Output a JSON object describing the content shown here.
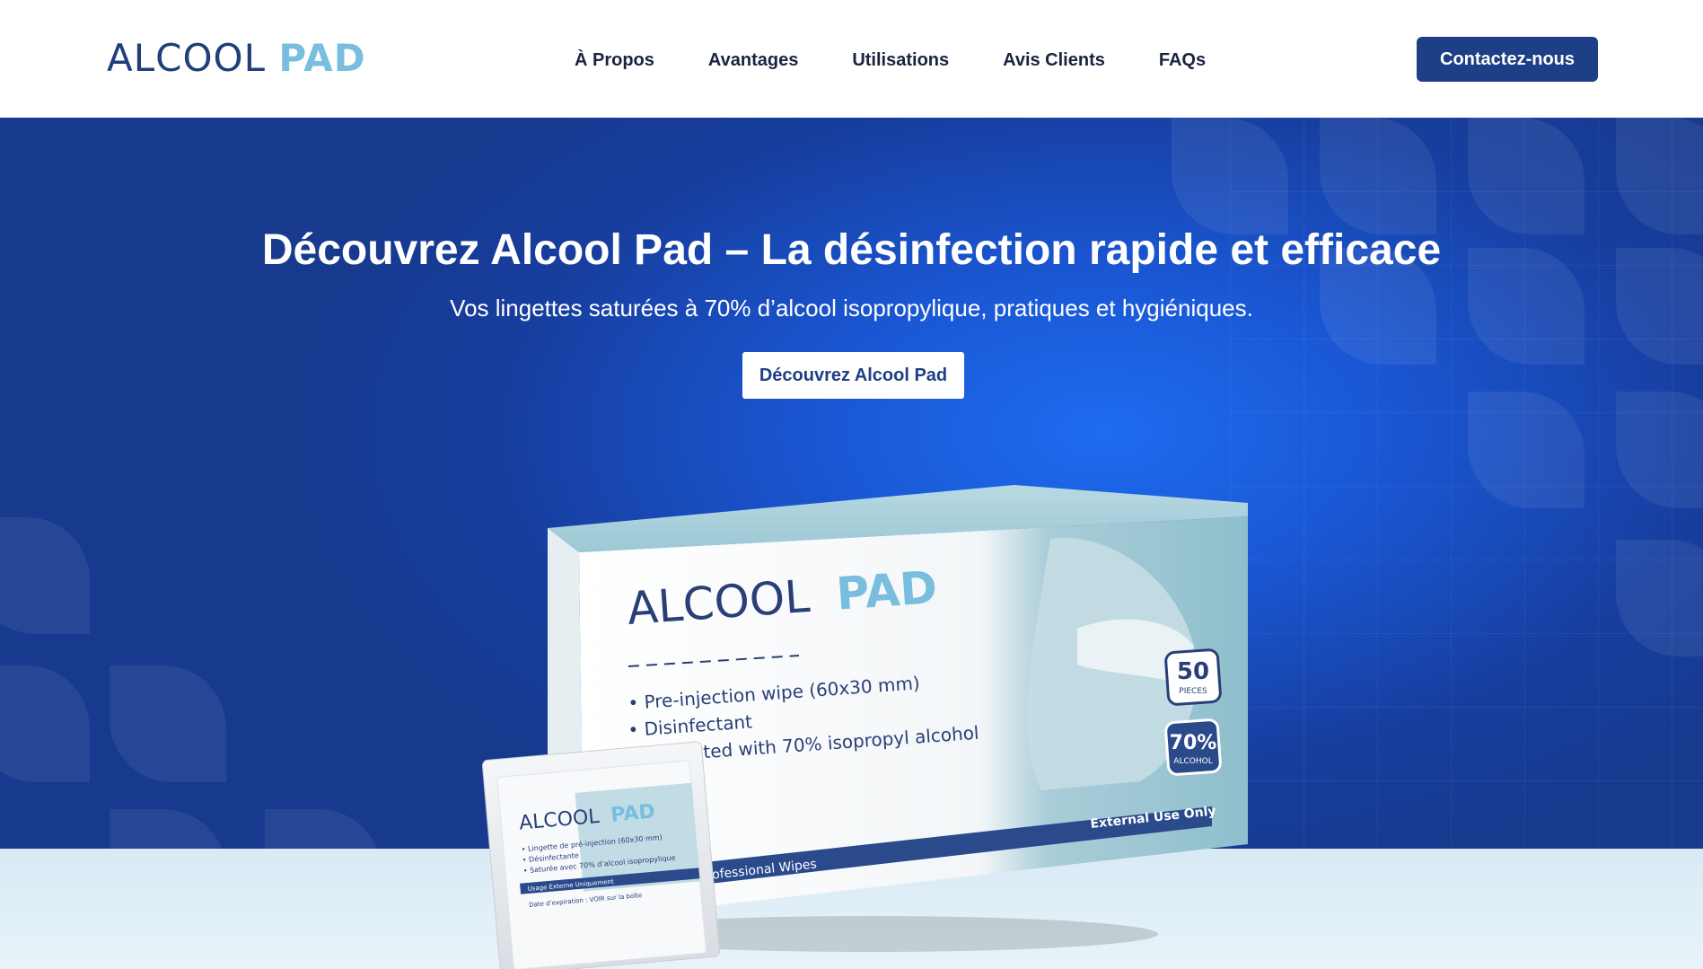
{
  "header": {
    "logo_word1": "ALCOOL",
    "logo_word2": "PAD",
    "nav": [
      {
        "label": "À Propos"
      },
      {
        "label": "Avantages"
      },
      {
        "label": "Utilisations"
      },
      {
        "label": "Avis Clients"
      },
      {
        "label": "FAQs"
      }
    ],
    "cta_label": "Contactez-nous"
  },
  "hero": {
    "title": "Découvrez Alcool Pad – La désinfection rapide et efficace",
    "subtitle": "Vos lingettes saturées à 70% d’alcool isopropylique, pratiques et hygiéniques.",
    "button_label": "Découvrez Alcool Pad"
  },
  "product": {
    "brand_word1": "ALCOOL",
    "brand_word2": "PAD",
    "bullet1": "• Pre-injection wipe (60x30 mm)",
    "bullet2": "• Disinfectant",
    "bullet3": "• Saturated with 70% isopropyl alcohol",
    "stripe_text": "Professional Wipes",
    "external_use": "External Use Only",
    "count_badge": "50",
    "count_unit": "PIECES",
    "alcohol_badge": "70%",
    "alcohol_unit": "ALCOHOL",
    "sachet_brand1": "ALCOOL",
    "sachet_brand2": "PAD",
    "sachet_line1": "• Lingette de pré-injection (60x30 mm)",
    "sachet_line2": "• Désinfectante",
    "sachet_line3": "• Saturée avec 70% d’alcool isopropylique",
    "sachet_stripe": "Usage Externe Uniquement",
    "sachet_expiry": "Date d’expiration : VOIR sur la boîte"
  },
  "colors": {
    "brand_dark": "#1f3f7a",
    "brand_light": "#79bede",
    "cta_bg": "#1d3f85",
    "hero_blue": "#1a57d4"
  }
}
